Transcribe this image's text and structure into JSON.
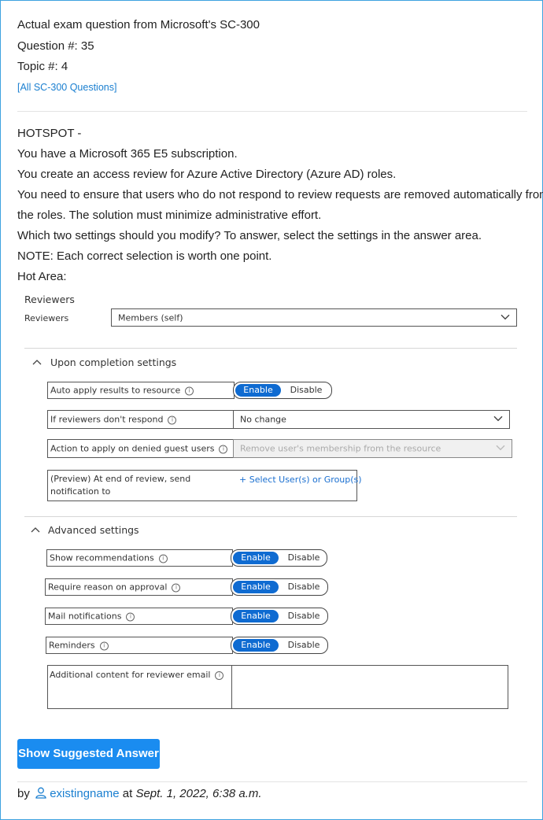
{
  "header": {
    "line1": "Actual exam question from Microsoft's SC-300",
    "question_no": "Question #: 35",
    "topic_no": "Topic #: 4",
    "all_link": "[All SC-300 Questions]"
  },
  "question": {
    "lines": [
      "HOTSPOT -",
      "You have a Microsoft 365 E5 subscription.",
      "You create an access review for Azure Active Directory (Azure AD) roles.",
      "You need to ensure that users who do not respond to review requests are removed automatically from",
      "the roles. The solution must minimize administrative effort.",
      "Which two settings should you modify? To answer, select the settings in the answer area.",
      "NOTE: Each correct selection is worth one point.",
      "Hot Area:"
    ]
  },
  "hot_area": {
    "reviewers_heading": "Reviewers",
    "reviewers_label": "Reviewers",
    "reviewers_value": "Members (self)",
    "completion_heading": "Upon completion settings",
    "auto_apply_label": "Auto apply results to resource",
    "no_respond_label": "If reviewers don't respond",
    "no_respond_value": "No change",
    "denied_guest_label": "Action to apply on denied guest users",
    "denied_guest_value": "Remove user's membership from the resource",
    "notify_label_1": "(Preview) At end of review, send",
    "notify_label_2": "notification to",
    "notify_link": "+ Select User(s) or Group(s)",
    "advanced_heading": "Advanced settings",
    "show_rec_label": "Show recommendations",
    "require_reason_label": "Require reason on approval",
    "mail_label": "Mail notifications",
    "reminders_label": "Reminders",
    "additional_label": "Additional content for reviewer email",
    "enable": "Enable",
    "disable": "Disable",
    "info_glyph": "i",
    "collapse_glyph": "^"
  },
  "actions": {
    "show_answer": "Show Suggested Answer"
  },
  "footer": {
    "by": "by",
    "user": "existingname",
    "at": "at",
    "date": "Sept. 1, 2022, 6:38 a.m."
  },
  "colors": {
    "accent": "#1a8cf0",
    "link": "#1a7fd0",
    "toggle_on": "#0f6bd1",
    "border": "#3ea2e0"
  }
}
